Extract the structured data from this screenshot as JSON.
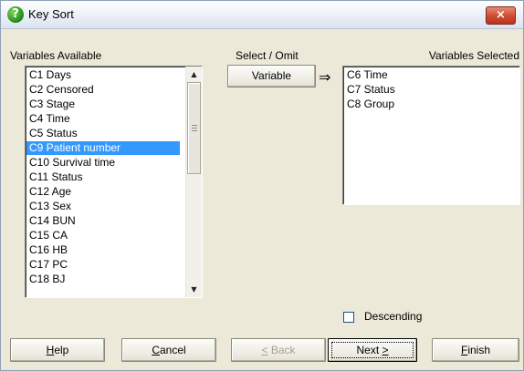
{
  "window": {
    "title": "Key Sort",
    "icon": "help-question-icon",
    "close_label": "×"
  },
  "labels": {
    "variables_available": "Variables Available",
    "select_omit": "Select / Omit",
    "variables_selected": "Variables Selected"
  },
  "available_list": {
    "items": [
      "C1 Days",
      "C2 Censored",
      "C3 Stage",
      "C4 Time",
      "C5 Status",
      "C9 Patient number",
      "C10 Survival time",
      "C11 Status",
      "C12 Age",
      "C13 Sex",
      "C14 BUN",
      "C15 CA",
      "C16 HB",
      "C17 PC",
      "C18 BJ"
    ],
    "selected_index": 5
  },
  "variable_button": {
    "label": "Variable",
    "arrow": "⇒"
  },
  "selected_list": {
    "items": [
      "C6 Time",
      "C7 Status",
      "C8 Group"
    ]
  },
  "descending": {
    "label": "Descending",
    "checked": false
  },
  "buttons": {
    "help": "Help",
    "cancel": "Cancel",
    "back": "< Back",
    "next": "Next >",
    "finish": "Finish"
  }
}
